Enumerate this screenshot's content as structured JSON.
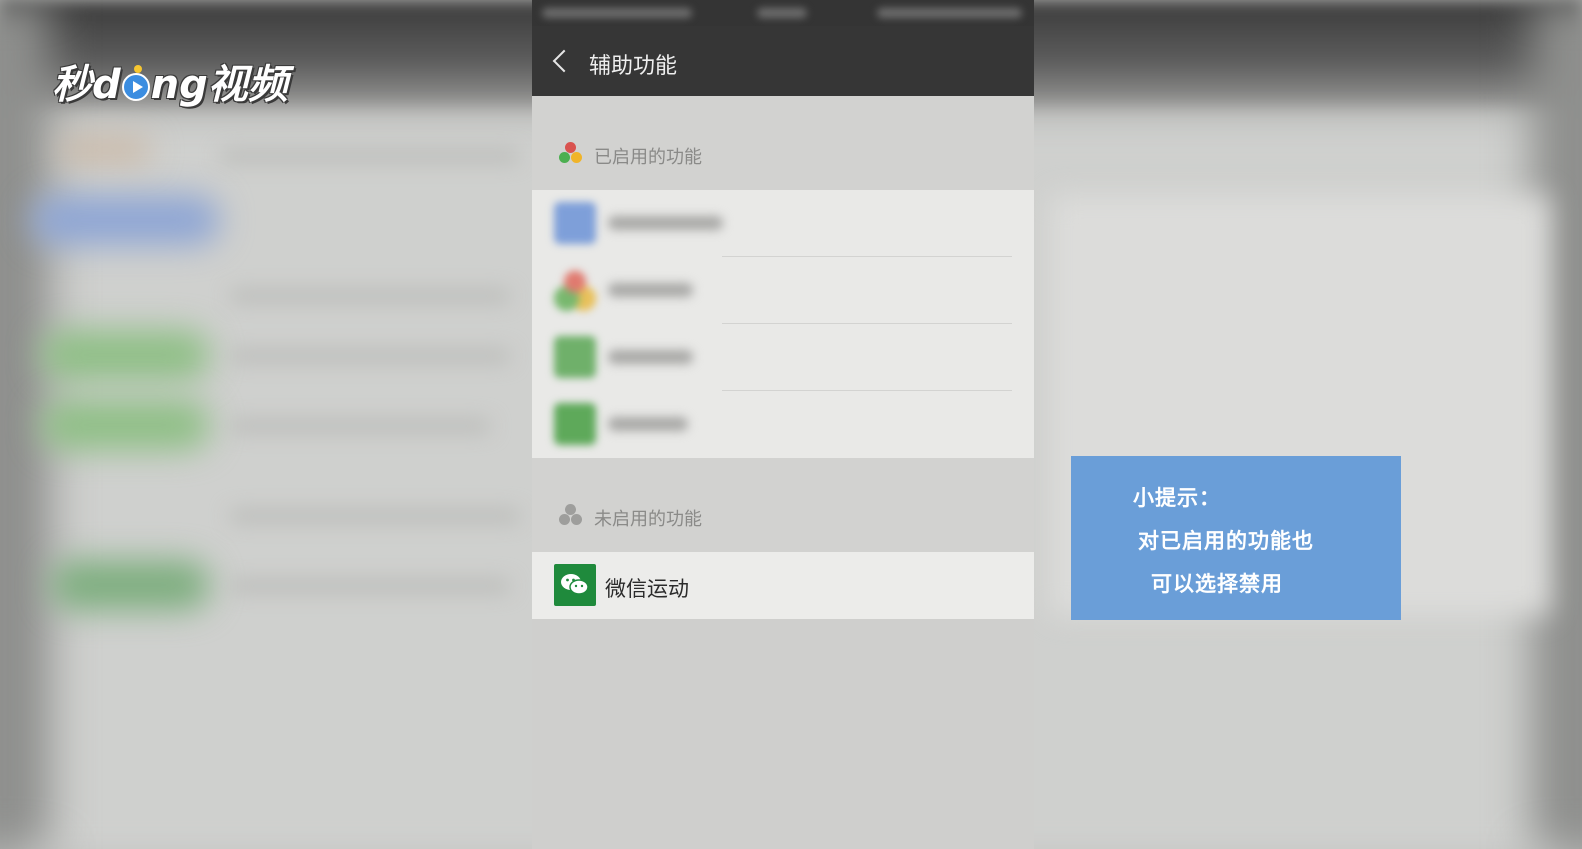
{
  "watermark": {
    "logo_text_before": "秒d",
    "logo_text_after": "ng视频",
    "play_icon": "play-circle-icon"
  },
  "nav": {
    "title": "辅助功能",
    "back_icon": "chevron-left-icon"
  },
  "sections": {
    "enabled": {
      "label": "已启用的功能",
      "icon": "three-dots-icon",
      "icon_colors": [
        "#d9534f",
        "#4caf50",
        "#f0b429"
      ],
      "items_count_visible": 4
    },
    "disabled": {
      "label": "未启用的功能",
      "icon": "three-dots-icon",
      "items": [
        {
          "label": "微信运动",
          "icon": "wechat-icon",
          "icon_color": "#1f8a3c"
        }
      ]
    }
  },
  "tip": {
    "title": "小提示：",
    "line1": "对已启用的功能也",
    "line2": "可以选择禁用",
    "background": "#6a9ed8"
  }
}
